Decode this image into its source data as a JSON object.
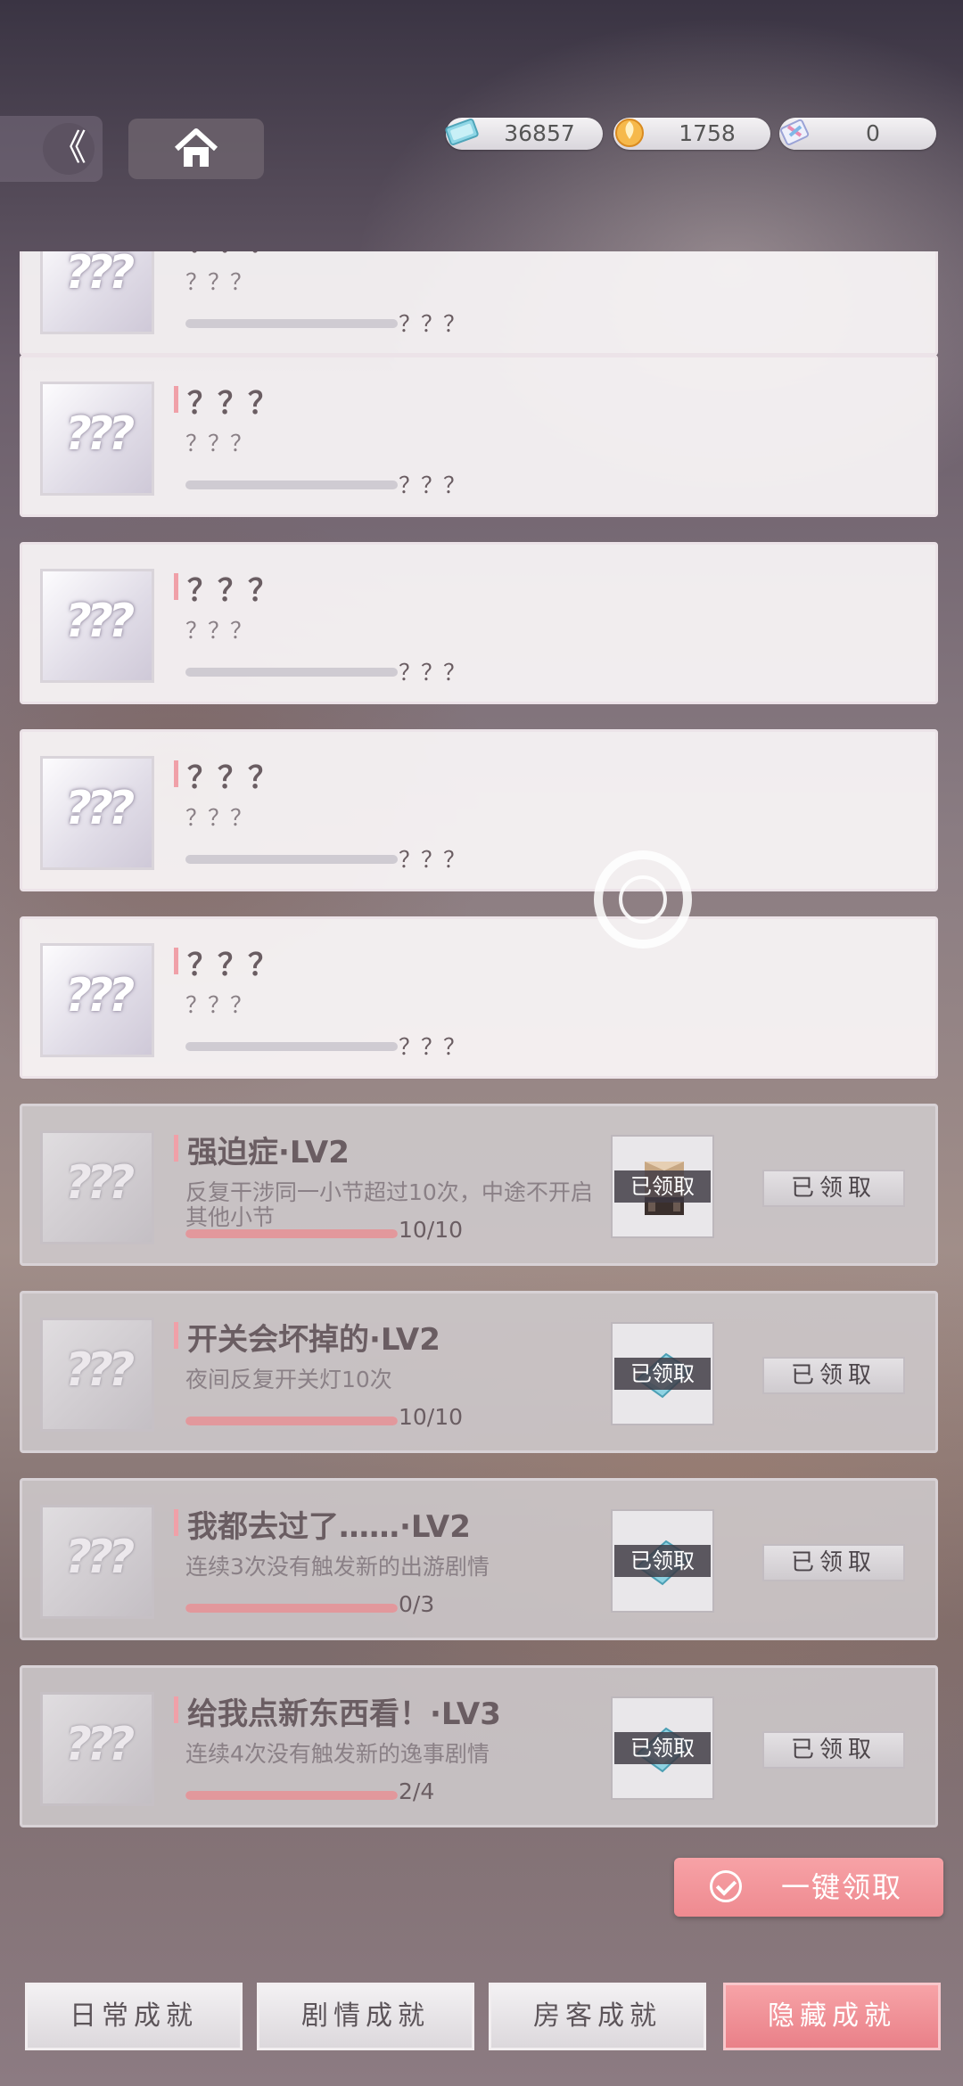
{
  "currencies": [
    {
      "icon": "ticket-icon",
      "value": "36857"
    },
    {
      "icon": "coin-icon",
      "value": "1758"
    },
    {
      "icon": "crystal-icon",
      "value": "0"
    }
  ],
  "header": {
    "back_glyph": "《"
  },
  "achievements": [
    {
      "state": "locked",
      "title": "？？？",
      "desc": "？？？",
      "progress_text": "？？？",
      "progress": 0
    },
    {
      "state": "locked",
      "title": "？？？",
      "desc": "？？？",
      "progress_text": "？？？",
      "progress": 0
    },
    {
      "state": "locked",
      "title": "？？？",
      "desc": "？？？",
      "progress_text": "？？？",
      "progress": 0
    },
    {
      "state": "locked",
      "title": "？？？",
      "desc": "？？？",
      "progress_text": "？？？",
      "progress": 0
    },
    {
      "state": "locked",
      "title": "？？？",
      "desc": "？？？",
      "progress_text": "？？？",
      "progress": 0
    },
    {
      "state": "claimed",
      "title": "强迫症·LV2",
      "desc": "反复干涉同一小节超过10次，中途不开启其他小节",
      "progress_text": "10/10",
      "progress": 1.0,
      "reward_icon": "furniture-cabinet-icon",
      "reward_badge": "已领取",
      "claim_label": "已领取"
    },
    {
      "state": "claimed",
      "title": "开关会坏掉的·LV2",
      "desc": "夜间反复开关灯10次",
      "progress_text": "10/10",
      "progress": 1.0,
      "reward_icon": "blue-ticket-icon",
      "reward_badge": "已领取",
      "claim_label": "已领取"
    },
    {
      "state": "claimed",
      "title": "我都去过了……·LV2",
      "desc": "连续3次没有触发新的出游剧情",
      "progress_text": "0/3",
      "progress": 1.0,
      "reward_icon": "blue-ticket-icon",
      "reward_badge": "已领取",
      "claim_label": "已领取"
    },
    {
      "state": "claimed",
      "title": "给我点新东西看！·LV3",
      "desc": "连续4次没有触发新的逸事剧情",
      "progress_text": "2/4",
      "progress": 1.0,
      "reward_icon": "blue-ticket-icon",
      "reward_badge": "已领取",
      "claim_label": "已领取"
    }
  ],
  "thumb_text": "???",
  "onekey_label": "一键领取",
  "tabs": [
    {
      "label": "日常成就",
      "active": false
    },
    {
      "label": "剧情成就",
      "active": false
    },
    {
      "label": "房客成就",
      "active": false
    },
    {
      "label": "隐藏成就",
      "active": true
    }
  ],
  "colors": {
    "accent": "#ee8a90",
    "progress_fill": "#e2989c"
  }
}
